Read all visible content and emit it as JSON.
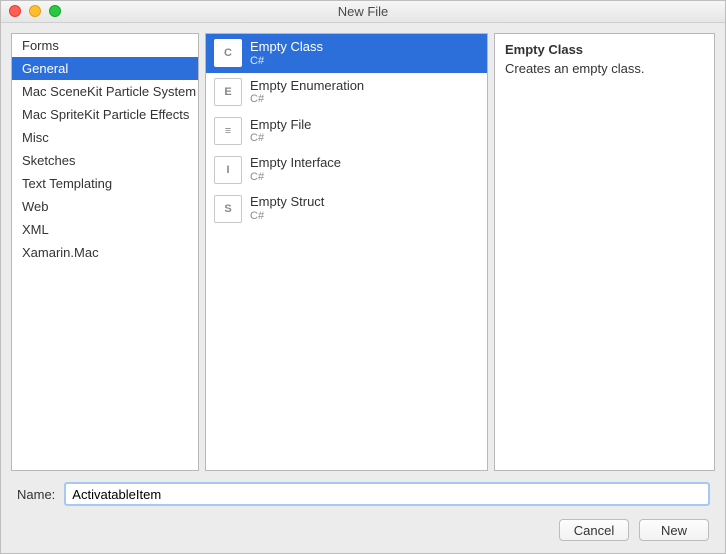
{
  "title": "New File",
  "categories": [
    "Forms",
    "General",
    "Mac SceneKit Particle System",
    "Mac SpriteKit Particle Effects",
    "Misc",
    "Sketches",
    "Text Templating",
    "Web",
    "XML",
    "Xamarin.Mac"
  ],
  "selectedCategoryIndex": 1,
  "templates": [
    {
      "name": "Empty Class",
      "sub": "C#",
      "glyph": "C"
    },
    {
      "name": "Empty Enumeration",
      "sub": "C#",
      "glyph": "E"
    },
    {
      "name": "Empty File",
      "sub": "C#",
      "glyph": "≡"
    },
    {
      "name": "Empty Interface",
      "sub": "C#",
      "glyph": "I"
    },
    {
      "name": "Empty Struct",
      "sub": "C#",
      "glyph": "S"
    }
  ],
  "selectedTemplateIndex": 0,
  "description": {
    "title": "Empty Class",
    "body": "Creates an empty class."
  },
  "nameLabel": "Name:",
  "nameValue": "ActivatableItem",
  "buttons": {
    "cancel": "Cancel",
    "new": "New"
  }
}
